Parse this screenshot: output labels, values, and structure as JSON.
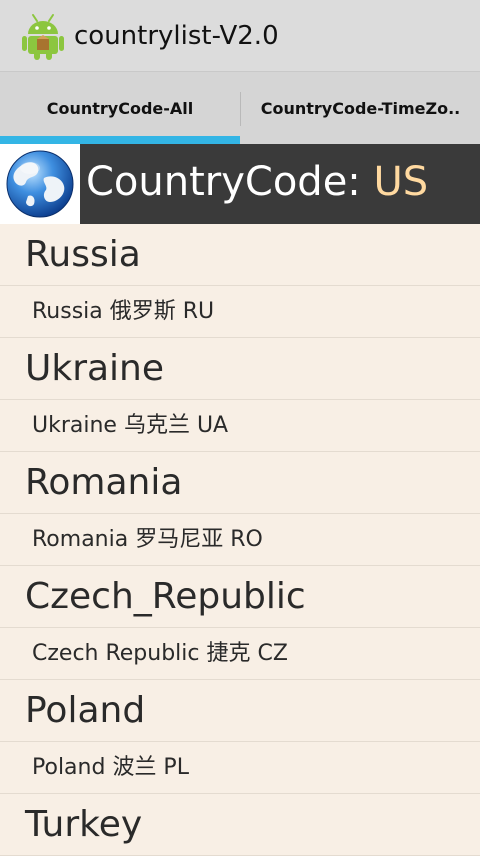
{
  "app": {
    "title": "countrylist-V2.0",
    "icon": "android-icon"
  },
  "tabs": [
    {
      "label": "CountryCode-All",
      "selected": true
    },
    {
      "label": "CountryCode-TimeZo..",
      "selected": false
    }
  ],
  "header": {
    "icon": "globe-icon",
    "label": "CountryCode: ",
    "value": "US"
  },
  "groups": [
    {
      "title": "Russia",
      "items": [
        "Russia 俄罗斯 RU"
      ]
    },
    {
      "title": "Ukraine",
      "items": [
        "Ukraine 乌克兰 UA"
      ]
    },
    {
      "title": "Romania",
      "items": [
        "Romania 罗马尼亚 RO"
      ]
    },
    {
      "title": "Czech_Republic",
      "items": [
        "Czech Republic 捷克 CZ"
      ]
    },
    {
      "title": "Poland",
      "items": [
        "Poland 波兰 PL"
      ]
    },
    {
      "title": "Turkey",
      "items": []
    }
  ],
  "colors": {
    "tab_indicator": "#33b5e5",
    "country_code_value": "#ffd9a0",
    "list_background": "#f8efe5",
    "header_background": "#3a3a3a"
  }
}
